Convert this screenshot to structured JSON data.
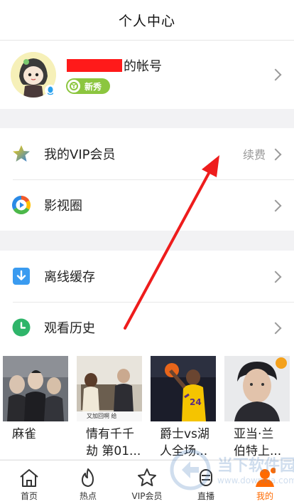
{
  "header": {
    "title": "个人中心"
  },
  "profile": {
    "account_suffix": "的帐号",
    "level_badge": "新秀"
  },
  "menu": {
    "vip": {
      "label": "我的VIP会员",
      "extra": "续费"
    },
    "circle": {
      "label": "影视圈"
    },
    "offline": {
      "label": "离线缓存"
    },
    "history": {
      "label": "观看历史"
    }
  },
  "history_items": [
    {
      "line1": "麻雀",
      "line2": ""
    },
    {
      "line1": "情有千千",
      "line2": "劫 第01...",
      "poster_text": "又加回啊 给"
    },
    {
      "line1": "爵士vs湖",
      "line2": "人全场...",
      "poster_text": "24"
    },
    {
      "line1": "亚当·兰",
      "line2": "伯特上..."
    }
  ],
  "tabbar": {
    "items": [
      {
        "label": "首页",
        "icon": "home-icon"
      },
      {
        "label": "热点",
        "icon": "flame-icon"
      },
      {
        "label": "VIP会员",
        "icon": "vip-star-icon"
      },
      {
        "label": "直播",
        "icon": "live-icon"
      },
      {
        "label": "我的",
        "icon": "profile-icon",
        "active": true
      }
    ]
  },
  "watermark": {
    "name": "当下软件园",
    "url": "www.downxia.com"
  },
  "colors": {
    "accent": "#ff6a00",
    "annotation": "#ee1c1c",
    "badge": "#8cc63f"
  }
}
